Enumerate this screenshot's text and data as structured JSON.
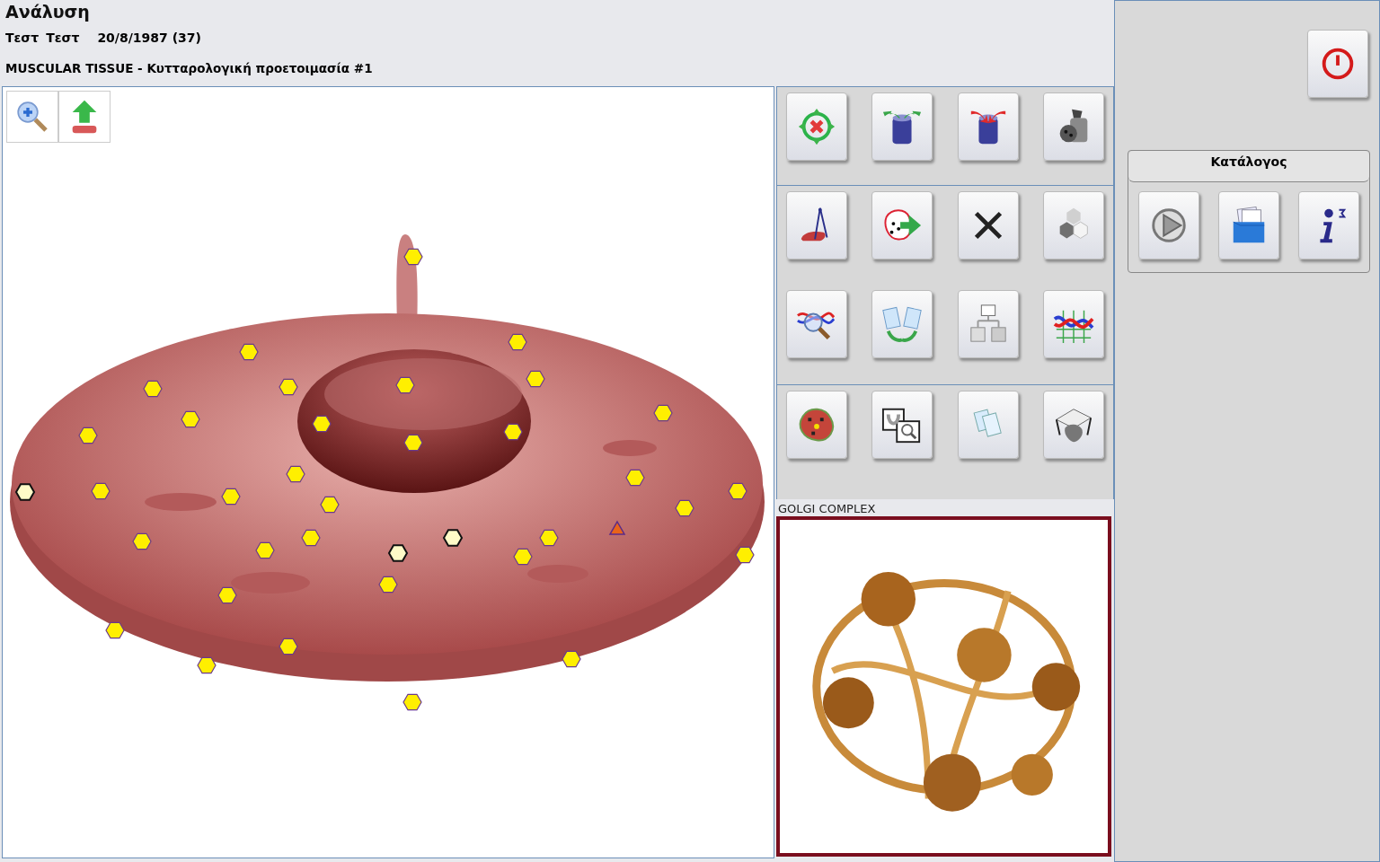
{
  "header": {
    "title": "Ανάλυση",
    "first_name": "Τεστ",
    "last_name": "Τεστ",
    "birth_date": "20/8/1987 (37)"
  },
  "section_title": "MUSCULAR TISSUE - Κυτταρολογική προετοιμασία #1",
  "markers": [
    {
      "kind": "hexagon",
      "selected": false
    },
    {
      "kind": "hexagon",
      "selected": false
    },
    {
      "kind": "hexagon",
      "selected": false
    },
    {
      "kind": "hexagon",
      "selected": false
    },
    {
      "kind": "hexagon",
      "selected": false
    },
    {
      "kind": "hexagon",
      "selected": false
    },
    {
      "kind": "hexagon",
      "selected": false
    },
    {
      "kind": "hexagon",
      "selected": false
    },
    {
      "kind": "hexagon",
      "selected": false
    },
    {
      "kind": "hexagon",
      "selected": false
    },
    {
      "kind": "hexagon",
      "selected": false
    },
    {
      "kind": "hexagon",
      "selected": false
    },
    {
      "kind": "hexagon",
      "selected": false
    },
    {
      "kind": "hexagon",
      "selected": false
    },
    {
      "kind": "hexagon",
      "selected": false
    },
    {
      "kind": "hexagon",
      "selected": true
    },
    {
      "kind": "hexagon",
      "selected": false
    },
    {
      "kind": "hexagon",
      "selected": false
    },
    {
      "kind": "hexagon",
      "selected": false
    },
    {
      "kind": "hexagon",
      "selected": false
    },
    {
      "kind": "hexagon",
      "selected": false
    },
    {
      "kind": "hexagon",
      "selected": false
    },
    {
      "kind": "hexagon",
      "selected": false
    },
    {
      "kind": "hexagon",
      "selected": false
    },
    {
      "kind": "hexagon",
      "selected": true
    },
    {
      "kind": "hexagon",
      "selected": true
    },
    {
      "kind": "hexagon",
      "selected": false
    },
    {
      "kind": "hexagon",
      "selected": false
    },
    {
      "kind": "triangle",
      "selected": false
    },
    {
      "kind": "hexagon",
      "selected": false
    },
    {
      "kind": "hexagon",
      "selected": false
    },
    {
      "kind": "hexagon",
      "selected": false
    },
    {
      "kind": "hexagon",
      "selected": false
    },
    {
      "kind": "hexagon",
      "selected": false
    },
    {
      "kind": "hexagon",
      "selected": false
    },
    {
      "kind": "hexagon",
      "selected": false
    },
    {
      "kind": "hexagon",
      "selected": false
    }
  ],
  "preview": {
    "label": "GOLGI COMPLEX"
  },
  "catalog": {
    "title": "Κατάλογος"
  }
}
